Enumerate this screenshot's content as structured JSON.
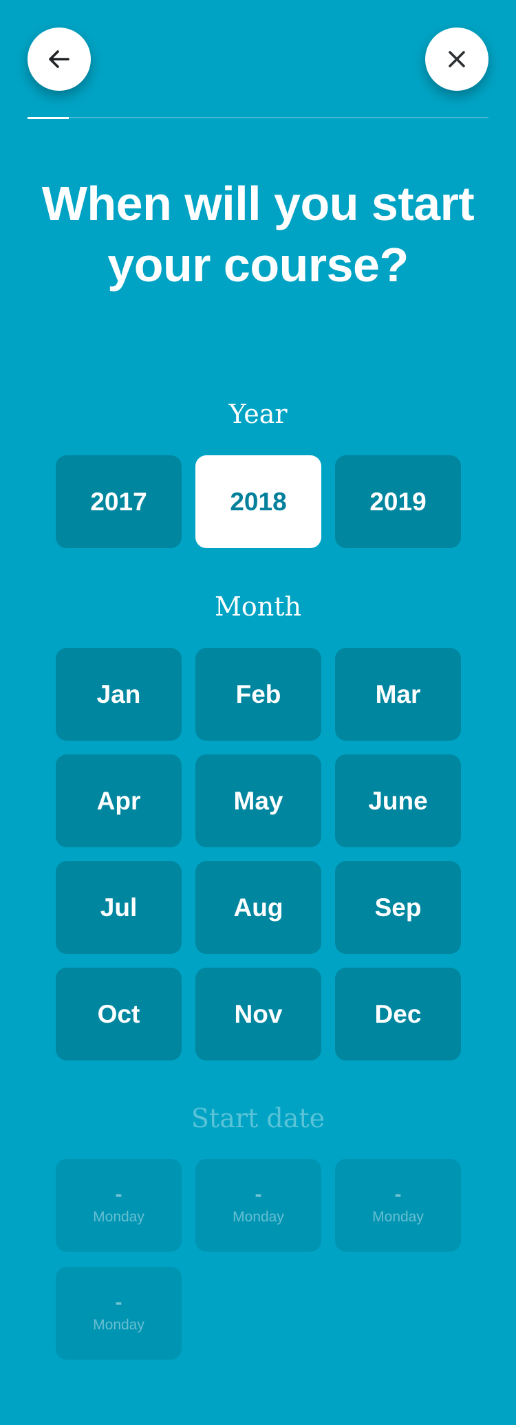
{
  "header": {
    "back_icon": "arrow-left-icon",
    "close_icon": "close-icon",
    "progress": 0.09
  },
  "title": "When will you start your course?",
  "year": {
    "label": "Year",
    "options": [
      "2017",
      "2018",
      "2019"
    ],
    "selected": "2018"
  },
  "month": {
    "label": "Month",
    "options": [
      "Jan",
      "Feb",
      "Mar",
      "Apr",
      "May",
      "June",
      "Jul",
      "Aug",
      "Sep",
      "Oct",
      "Nov",
      "Dec"
    ]
  },
  "start_date": {
    "label": "Start date",
    "options": [
      {
        "date": "-",
        "day": "Monday"
      },
      {
        "date": "-",
        "day": "Monday"
      },
      {
        "date": "-",
        "day": "Monday"
      },
      {
        "date": "-",
        "day": "Monday"
      }
    ]
  },
  "colors": {
    "background": "#00a3c4",
    "tile": "#00869f",
    "selected_tile": "#ffffff",
    "selected_text": "#04809b"
  }
}
